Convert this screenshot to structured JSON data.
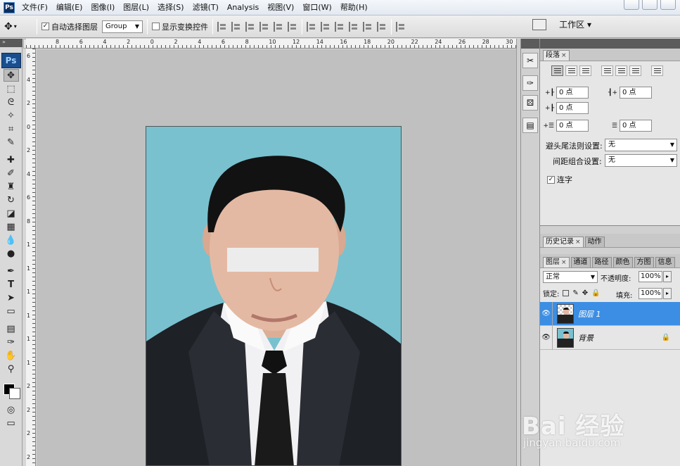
{
  "app": {
    "logo_text": "Ps"
  },
  "menu": [
    "文件(F)",
    "编辑(E)",
    "图像(I)",
    "图层(L)",
    "选择(S)",
    "滤镜(T)",
    "Analysis",
    "视图(V)",
    "窗口(W)",
    "帮助(H)"
  ],
  "options_bar": {
    "auto_select_label": "自动选择图层",
    "auto_select_checked": true,
    "auto_select_target": "Group",
    "show_transform_label": "显示变换控件",
    "show_transform_checked": false,
    "workspace_label": "工作区 ▾"
  },
  "ruler": {
    "top_labels": [
      "8",
      "6",
      "4",
      "2",
      "0",
      "2",
      "4",
      "6",
      "8",
      "10",
      "12",
      "14",
      "16",
      "18",
      "20",
      "22",
      "24",
      "26",
      "28",
      "30"
    ],
    "left_labels": [
      "6",
      "4",
      "2",
      "0",
      "2",
      "4",
      "6",
      "8",
      "1",
      "1",
      "1",
      "1",
      "1",
      "1",
      "2",
      "2",
      "2",
      "2"
    ]
  },
  "paragraph_panel": {
    "tab": "段落",
    "indent_left": "0 点",
    "indent_right": "0 点",
    "indent_first": "0 点",
    "space_before": "0 点",
    "space_after": "0 点",
    "kinsoku_label": "避头尾法则设置:",
    "kinsoku_value": "无",
    "mojikumi_label": "间距组合设置:",
    "mojikumi_value": "无",
    "hyphenate_label": "连字",
    "hyphenate_checked": true
  },
  "history_panel": {
    "tabs": [
      "历史记录",
      "动作"
    ]
  },
  "layers_panel": {
    "tabs": [
      "图层",
      "通道",
      "路径",
      "颜色",
      "方图",
      "信息"
    ],
    "blend_mode": "正常",
    "opacity_label": "不透明度:",
    "opacity": "100%",
    "lock_label": "锁定:",
    "fill_label": "填充:",
    "fill": "100%",
    "layers": [
      {
        "name": "图层 1",
        "selected": true,
        "visible": true,
        "locked": false
      },
      {
        "name": "背景",
        "selected": false,
        "visible": true,
        "locked": true
      }
    ]
  },
  "watermark": {
    "main": "Bai 经验",
    "sub": "jingyan.baidu.com"
  },
  "colors": {
    "photo_bg": "#79c1cf",
    "selection": "#3c8ee4",
    "canvas_bg": "#c0c0c0"
  }
}
